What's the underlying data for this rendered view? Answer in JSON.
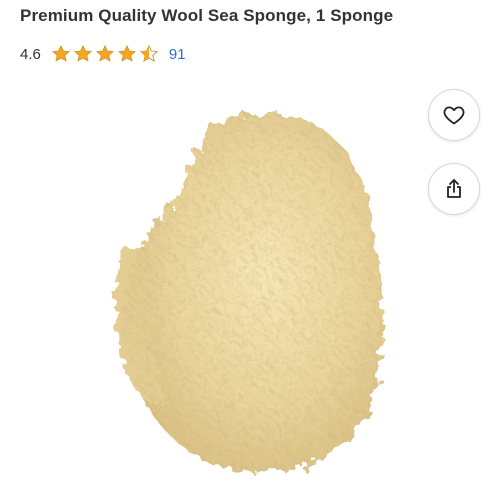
{
  "product": {
    "title": "Premium Quality Wool Sea Sponge, 1 Sponge",
    "rating": "4.6",
    "rating_value": 4.6,
    "stars_max": 5,
    "review_count": "91"
  },
  "actions": {
    "wishlist_icon": "heart-icon",
    "share_icon": "share-icon"
  },
  "colors": {
    "star": "#f5a623",
    "link": "#2a6fd6",
    "sponge": "#e8d6a0"
  }
}
